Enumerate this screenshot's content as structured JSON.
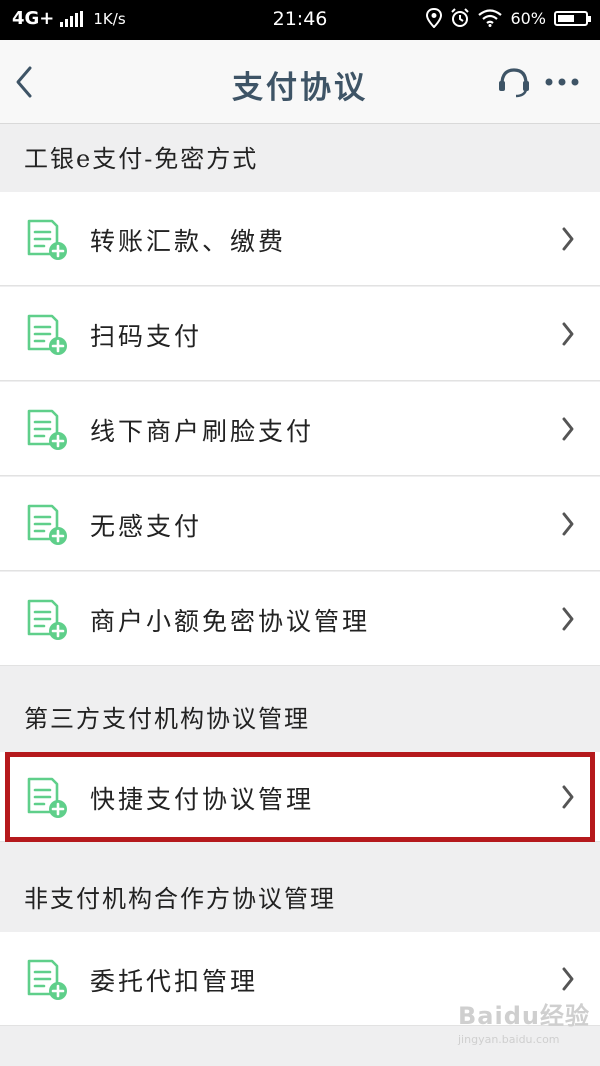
{
  "status_bar": {
    "network": "4G+",
    "speed": "1K/s",
    "time": "21:46",
    "battery": "60%",
    "battery_level": 0.6
  },
  "header": {
    "title": "支付协议"
  },
  "sections": [
    {
      "title": "工银e支付-免密方式",
      "items": [
        {
          "label": "转账汇款、缴费"
        },
        {
          "label": "扫码支付"
        },
        {
          "label": "线下商户刷脸支付"
        },
        {
          "label": "无感支付"
        },
        {
          "label": "商户小额免密协议管理"
        }
      ]
    },
    {
      "title": "第三方支付机构协议管理",
      "items": [
        {
          "label": "快捷支付协议管理",
          "highlighted": true
        }
      ]
    },
    {
      "title": "非支付机构合作方协议管理",
      "items": [
        {
          "label": "委托代扣管理"
        }
      ]
    }
  ],
  "watermark": {
    "logo": "Baidu经验",
    "url": "jingyan.baidu.com"
  },
  "colors": {
    "title": "#3e5466",
    "icon_green": "#5fcf8a",
    "highlight": "#b5191c",
    "background": "#efeff0"
  }
}
